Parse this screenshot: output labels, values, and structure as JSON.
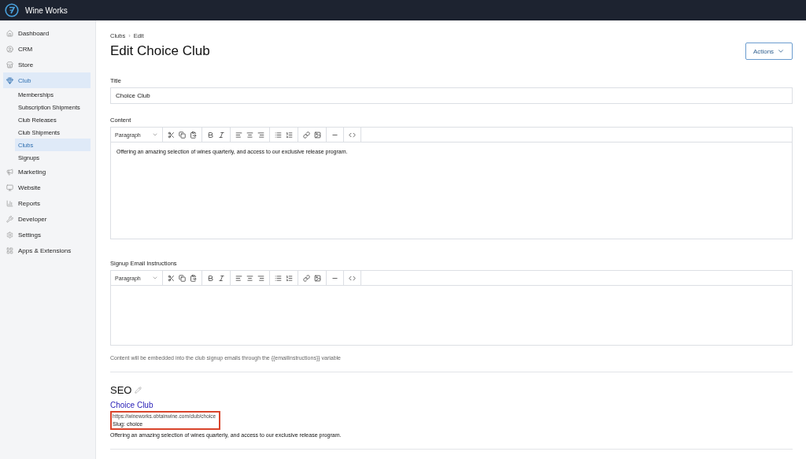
{
  "app": {
    "name": "Wine Works"
  },
  "sidebar": {
    "items": [
      {
        "label": "Dashboard",
        "selected": false
      },
      {
        "label": "CRM",
        "selected": false
      },
      {
        "label": "Store",
        "selected": false
      },
      {
        "label": "Club",
        "selected": true,
        "children": [
          {
            "label": "Memberships",
            "selected": false
          },
          {
            "label": "Subscription Shipments",
            "selected": false
          },
          {
            "label": "Club Releases",
            "selected": false
          },
          {
            "label": "Club Shipments",
            "selected": false
          },
          {
            "label": "Clubs",
            "selected": true
          },
          {
            "label": "Signups",
            "selected": false
          }
        ]
      },
      {
        "label": "Marketing",
        "selected": false
      },
      {
        "label": "Website",
        "selected": false
      },
      {
        "label": "Reports",
        "selected": false
      },
      {
        "label": "Developer",
        "selected": false
      },
      {
        "label": "Settings",
        "selected": false
      },
      {
        "label": "Apps & Extensions",
        "selected": false
      }
    ]
  },
  "breadcrumb": [
    "Clubs",
    "Edit"
  ],
  "breadcrumb_separator": "›",
  "page_title": "Edit Choice Club",
  "actions_button": "Actions",
  "form": {
    "title": {
      "label": "Title",
      "value": "Choice Club"
    },
    "editors": [
      {
        "label": "Content",
        "format": "Paragraph",
        "body": "Offering an amazing selection of wines quarterly, and access to our exclusive release program."
      },
      {
        "label": "Signup Email Instructions",
        "format": "Paragraph",
        "hint": "Content will be embedded into the club signup emails through the {{emailInstructions}} variable"
      }
    ]
  },
  "seo": {
    "heading": "SEO",
    "link_title": "Choice Club",
    "url": "https://wineworks.obtainwine.com/club/choice",
    "slug": "Slug: choice",
    "description": "Offering an amazing selection of wines quarterly, and access to our exclusive release program."
  }
}
